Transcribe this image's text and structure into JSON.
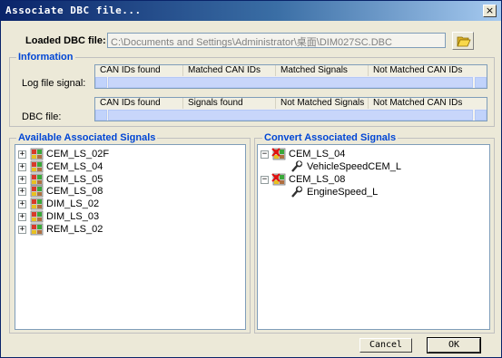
{
  "window": {
    "title": "Associate DBC file...",
    "close_glyph": "×"
  },
  "dbc": {
    "label": "Loaded DBC file:",
    "path": "C:\\Documents and Settings\\Administrator\\桌面\\DIM027SC.DBC",
    "browse_icon": "folder-open-icon"
  },
  "information": {
    "title": "Information",
    "log_label": "Log file signal:",
    "log_columns": [
      "CAN IDs found",
      "Matched CAN IDs",
      "Matched Signals",
      "Not Matched CAN IDs"
    ],
    "dbc_label": "DBC file:",
    "dbc_columns": [
      "CAN IDs found",
      "Signals found",
      "Not Matched Signals",
      "Not Matched CAN IDs"
    ]
  },
  "available": {
    "title": "Available Associated Signals",
    "items": [
      "CEM_LS_02F",
      "CEM_LS_04",
      "CEM_LS_05",
      "CEM_LS_08",
      "DIM_LS_02",
      "DIM_LS_03",
      "REM_LS_02"
    ]
  },
  "convert": {
    "title": "Convert Associated Signals",
    "groups": [
      {
        "name": "CEM_LS_04",
        "child": "VehicleSpeedCEM_L"
      },
      {
        "name": "CEM_LS_08",
        "child": "EngineSpeed_L"
      }
    ]
  },
  "buttons": {
    "cancel": "Cancel",
    "ok": "OK"
  },
  "colors": {
    "title_bar": "#0a246a",
    "group_title": "#0046d5",
    "dialog_bg": "#ece9d8"
  }
}
